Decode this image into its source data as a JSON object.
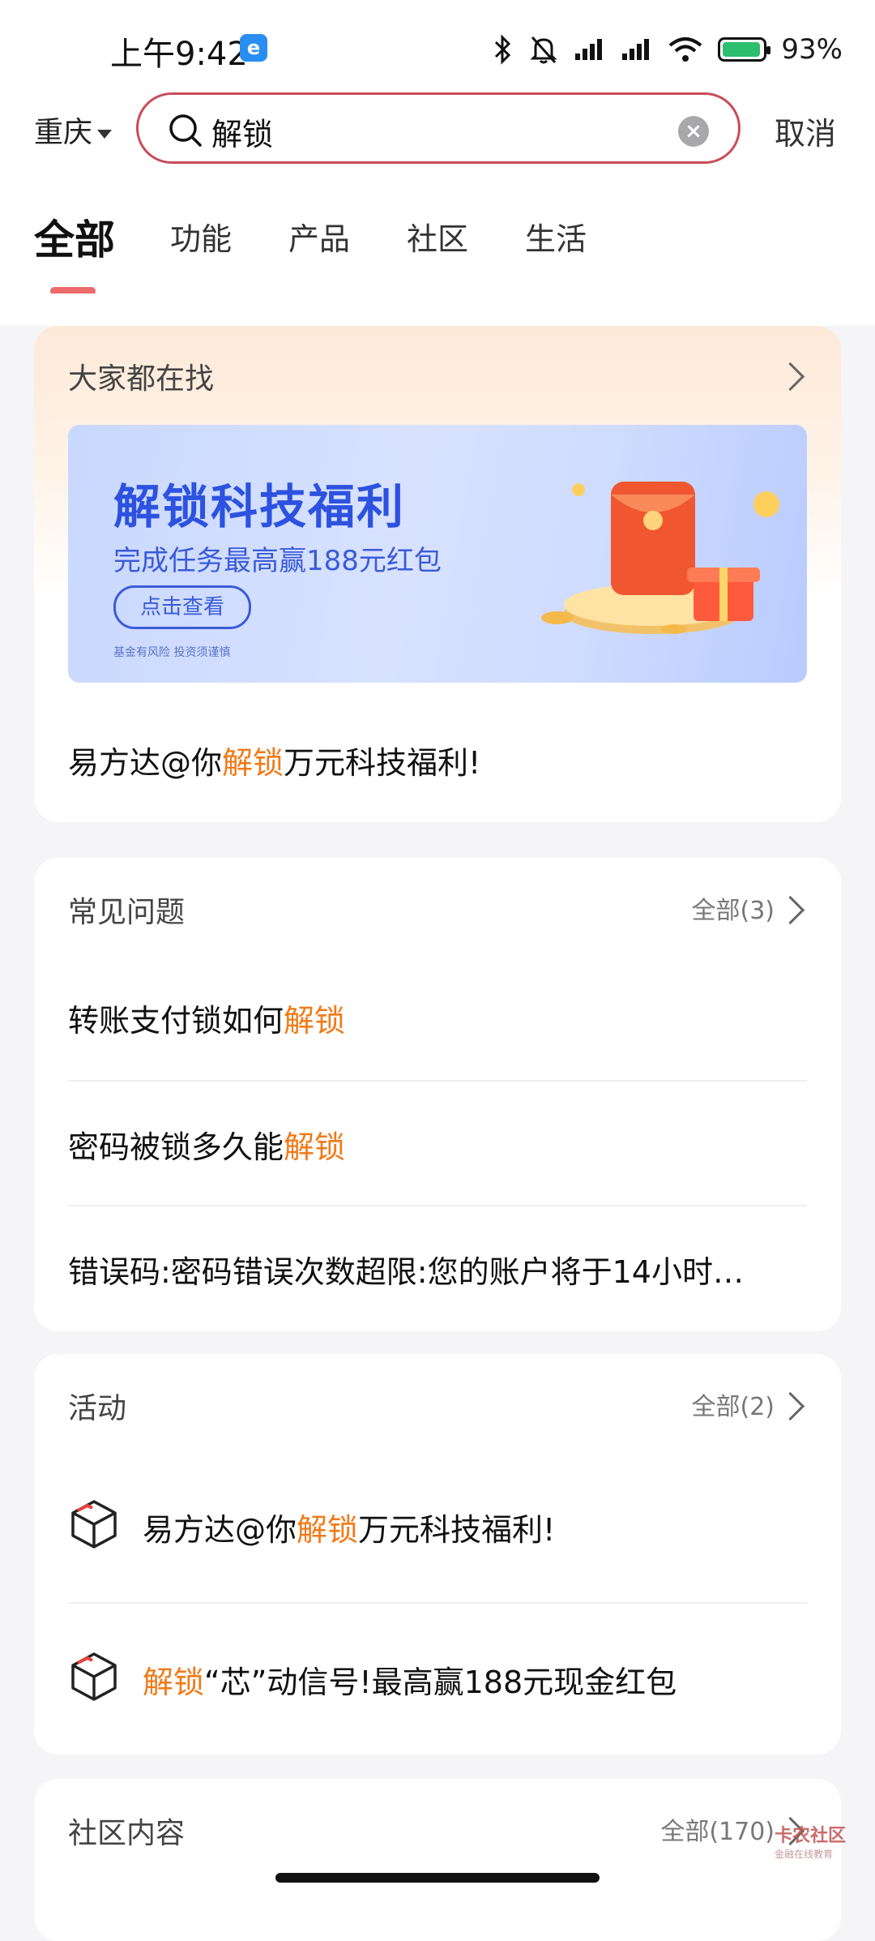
{
  "status_bar": {
    "time": "上午9:42",
    "battery_percent": "93%",
    "battery_level": 0.93
  },
  "search": {
    "city": "重庆",
    "query": "解锁",
    "cancel_label": "取消"
  },
  "tabs": [
    {
      "label": "全部",
      "active": true
    },
    {
      "label": "功能"
    },
    {
      "label": "产品"
    },
    {
      "label": "社区"
    },
    {
      "label": "生活"
    }
  ],
  "trending": {
    "title": "大家都在找",
    "banner": {
      "title": "解锁科技福利",
      "subtitle": "完成任务最高赢188元红包",
      "button": "点击查看",
      "note": "基金有风险 投资须谨慎"
    },
    "line": {
      "pre": "易方达@你",
      "hl": "解锁",
      "post": "万元科技福利!"
    }
  },
  "faq": {
    "title": "常见问题",
    "more": "全部(3)",
    "items": [
      {
        "pre": "转账支付锁如何",
        "hl": "解锁",
        "post": ""
      },
      {
        "pre": "密码被锁多久能",
        "hl": "解锁",
        "post": ""
      },
      {
        "pre": "错误码:密码错误次数超限:您的账户将于14小时…",
        "hl": "",
        "post": ""
      }
    ]
  },
  "activities": {
    "title": "活动",
    "more": "全部(2)",
    "items": [
      {
        "pre": "易方达@你",
        "hl": "解锁",
        "post": "万元科技福利!"
      },
      {
        "pre": "",
        "hl": "解锁",
        "post": "“芯”动信号!最高赢188元现金红包"
      }
    ]
  },
  "community": {
    "title": "社区内容",
    "more": "全部(170)"
  },
  "watermark": {
    "text": "卡农社区",
    "sub": "金融在线教育"
  },
  "colors": {
    "accent": "#f07a18",
    "search_border": "#c94d59",
    "tab_indicator": "#ec6b6b",
    "banner_blue": "#2d52e0"
  }
}
